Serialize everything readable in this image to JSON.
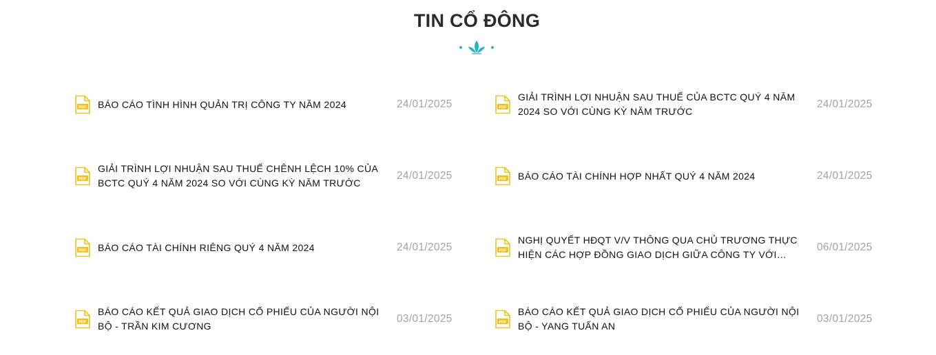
{
  "section": {
    "title": "TIN CỔ ĐÔNG"
  },
  "colors": {
    "divider_accent": "#2bb3c0",
    "pdf_icon": "#f2c21b"
  },
  "icons": {
    "divider": "leaf-divider-icon",
    "document": "pdf-file-icon"
  },
  "news": [
    {
      "title": "BÁO CÁO TÌNH HÌNH QUẢN TRỊ CÔNG TY NĂM 2024",
      "date": "24/01/2025"
    },
    {
      "title": "GIẢI TRÌNH LỢI NHUẬN SAU THUẾ CỦA BCTC QUÝ 4 NĂM 2024 SO VỚI CÙNG KỲ NĂM TRƯỚC",
      "date": "24/01/2025"
    },
    {
      "title": "GIẢI TRÌNH LỢI NHUẬN SAU THUẾ CHÊNH LỆCH 10% CỦA BCTC QUÝ 4 NĂM 2024 SO VỚI CÙNG KỲ NĂM TRƯỚC",
      "date": "24/01/2025"
    },
    {
      "title": "BÁO CÁO TÀI CHÍNH HỢP NHẤT QUÝ 4 NĂM 2024",
      "date": "24/01/2025"
    },
    {
      "title": "BÁO CÁO TÀI CHÍNH RIÊNG QUÝ 4 NĂM 2024",
      "date": "24/01/2025"
    },
    {
      "title": "NGHỊ QUYẾT HĐQT V/V THÔNG QUA CHỦ TRƯƠNG THỰC HIỆN CÁC HỢP ĐỒNG GIAO DỊCH GIỮA CÔNG TY VỚI NGƯỜ...",
      "date": "06/01/2025"
    },
    {
      "title": "BÁO CÁO KẾT QUẢ GIAO DỊCH CỔ PHIẾU CỦA NGƯỜI NỘI BỘ - TRẦN KIM CƯƠNG",
      "date": "03/01/2025"
    },
    {
      "title": "BÁO CÁO KẾT QUẢ GIAO DỊCH CỔ PHIẾU CỦA NGƯỜI NỘI BỘ - YANG TUẤN AN",
      "date": "03/01/2025"
    }
  ]
}
